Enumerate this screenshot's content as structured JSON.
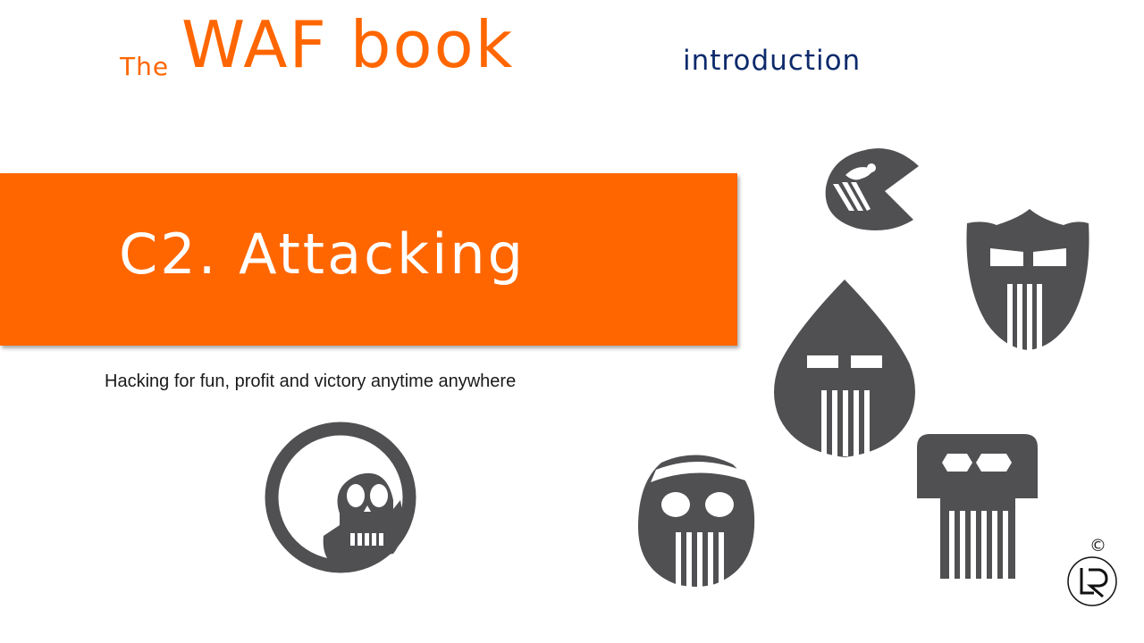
{
  "header": {
    "the": "The",
    "title": "WAF book",
    "section": "introduction"
  },
  "banner": {
    "title": "C2. Attacking"
  },
  "subtitle": "Hacking for fun, profit and victory anytime anywhere",
  "footer": {
    "copyright_symbol": "©"
  },
  "icons": [
    "round-skull-icon",
    "chomper-mask-icon",
    "shield-mask-icon",
    "drop-mask-icon",
    "bandana-skull-icon",
    "square-skull-icon",
    "lr-logo-icon"
  ],
  "colors": {
    "accent": "#ff6600",
    "navy": "#0d2a6b",
    "icon_gray": "#505053"
  }
}
